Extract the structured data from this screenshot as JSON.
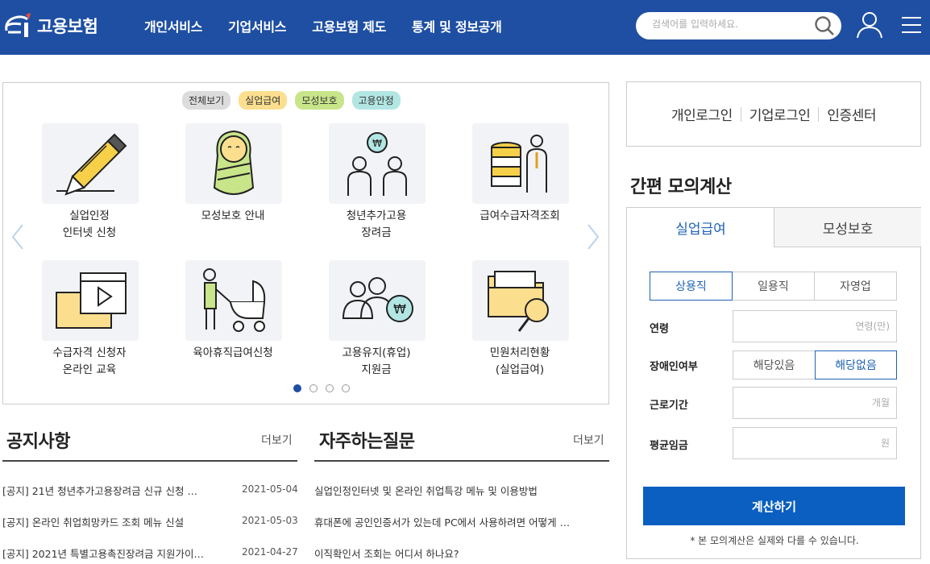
{
  "header": {
    "logo_text": "고용보험",
    "nav": [
      "개인서비스",
      "기업서비스",
      "고용보험 제도",
      "통계 및 정보공개"
    ],
    "search_placeholder": "검색어를 입력하세요."
  },
  "quick": {
    "chips": [
      {
        "label": "전체보기",
        "color": "#dcdcdc"
      },
      {
        "label": "실업급여",
        "color": "#fbdf8f"
      },
      {
        "label": "모성보호",
        "color": "#c8e58a"
      },
      {
        "label": "고용안정",
        "color": "#b2e6e3"
      }
    ],
    "tiles": [
      {
        "icon": "pencil-icon",
        "label1": "실업인정",
        "label2": "인터넷 신청"
      },
      {
        "icon": "baby-icon",
        "label1": "모성보호 안내",
        "label2": ""
      },
      {
        "icon": "youth-employment-icon",
        "label1": "청년추가고용",
        "label2": "장려금"
      },
      {
        "icon": "coins-person-icon",
        "label1": "급여수급자격조회",
        "label2": ""
      },
      {
        "icon": "video-education-icon",
        "label1": "수급자격 신청자",
        "label2": "온라인 교육"
      },
      {
        "icon": "stroller-icon",
        "label1": "육아휴직급여신청",
        "label2": ""
      },
      {
        "icon": "people-won-icon",
        "label1": "고용유지(휴업)",
        "label2": "지원금"
      },
      {
        "icon": "folder-search-icon",
        "label1": "민원처리현황",
        "label2": "(실업급여)"
      }
    ]
  },
  "notice": {
    "title": "공지사항",
    "more": "더보기",
    "items": [
      {
        "text": "[공지] 21년 청년추가고용장려금 신규 신청 …",
        "date": "2021-05-04"
      },
      {
        "text": "[공지] 온라인 취업희망카드 조회 메뉴 신설",
        "date": "2021-05-03"
      },
      {
        "text": "[공지] 2021년 특별고용촉진장려금 지원가이…",
        "date": "2021-04-27"
      }
    ]
  },
  "faq": {
    "title": "자주하는질문",
    "more": "더보기",
    "items": [
      "실업인정인터넷 및 온라인 취업특강 메뉴 및 이용방법",
      "휴대폰에 공인인증서가 있는데 PC에서 사용하려면 어떻게 …",
      "이직확인서 조회는 어디서 하나요?"
    ]
  },
  "login": [
    "개인로그인",
    "기업로그인",
    "인증센터"
  ],
  "calc": {
    "title": "간편 모의계산",
    "tabs": [
      "실업급여",
      "모성보호"
    ],
    "job_types": [
      "상용직",
      "일용직",
      "자영업"
    ],
    "age_label": "연령",
    "age_placeholder": "연령(만)",
    "disabled_label": "장애인여부",
    "disabled_options": [
      "해당있음",
      "해당없음"
    ],
    "period_label": "근로기간",
    "period_placeholder": "개월",
    "wage_label": "평균임금",
    "wage_placeholder": "원",
    "button": "계산하기",
    "note": "* 본 모의계산은 실제와 다를 수 있습니다."
  }
}
